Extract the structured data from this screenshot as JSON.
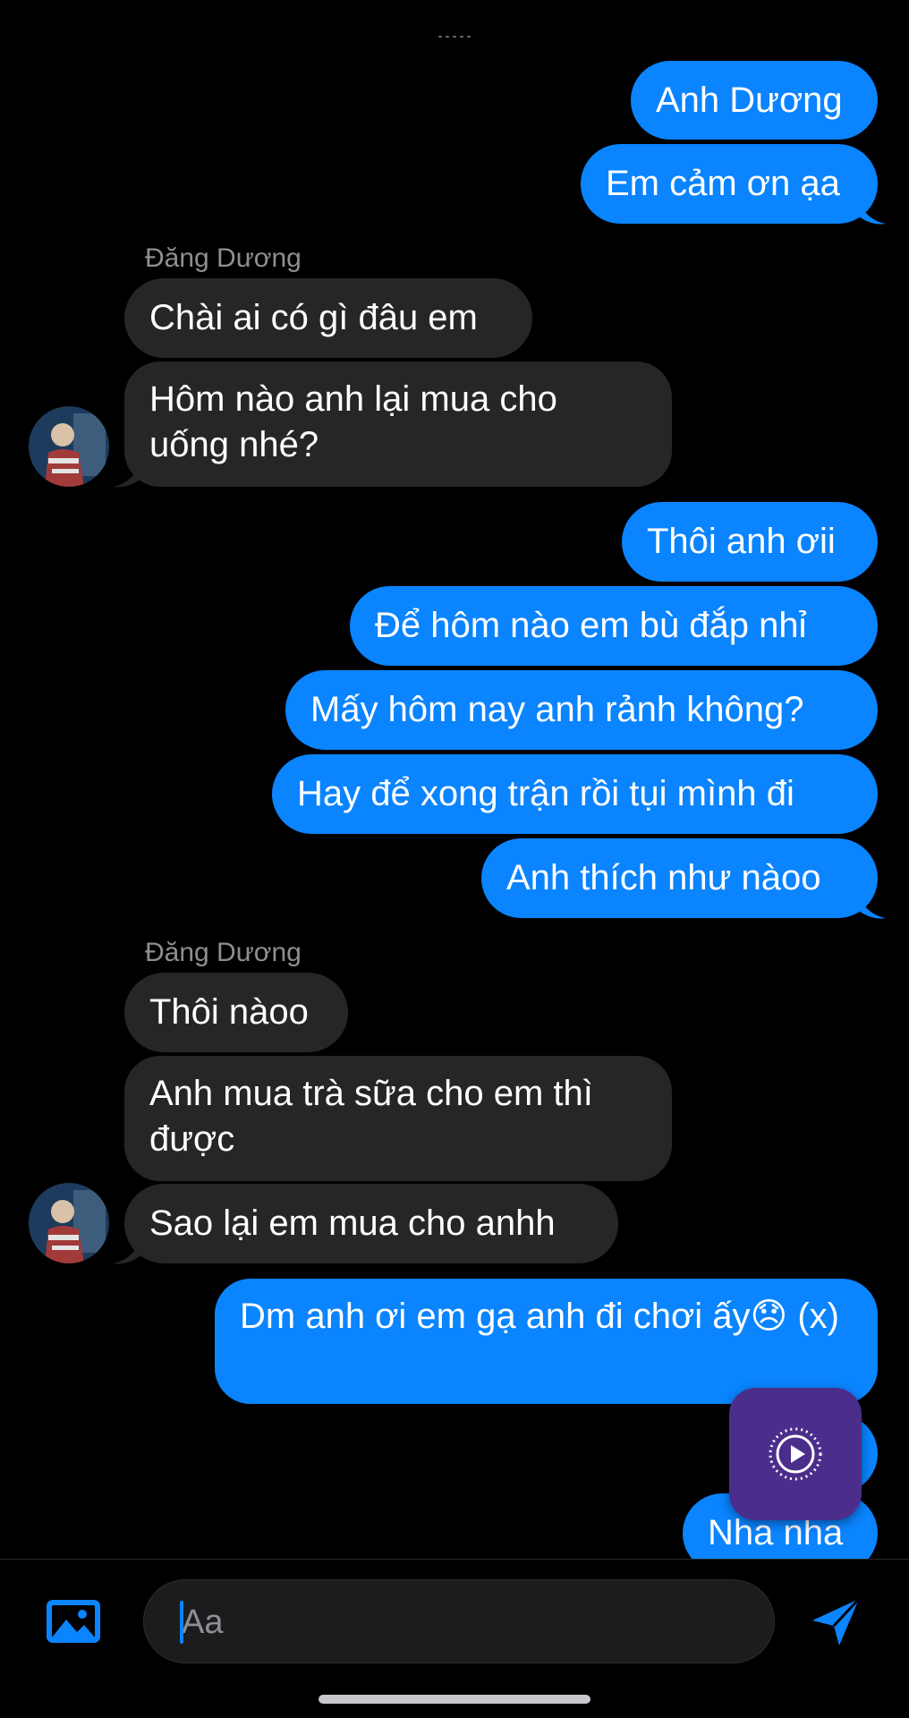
{
  "colors": {
    "outgoing_bubble": "#0a84ff",
    "incoming_bubble": "#262628",
    "video_button": "#4b2e8c"
  },
  "messages": [
    {
      "dir": "out",
      "text": "Anh Dương"
    },
    {
      "dir": "out",
      "text": "Em cảm ơn ạa"
    },
    {
      "dir": "in",
      "sender": "Đăng Dương",
      "text": "Chài ai có gì đâu em"
    },
    {
      "dir": "in",
      "text": "Hôm nào anh lại mua cho uống nhé?"
    },
    {
      "dir": "out",
      "text": "Thôi anh ơii"
    },
    {
      "dir": "out",
      "text": "Để hôm nào em bù đắp nhỉ"
    },
    {
      "dir": "out",
      "text": "Mấy hôm nay anh rảnh không?"
    },
    {
      "dir": "out",
      "text": "Hay để xong trận rồi tụi mình đi"
    },
    {
      "dir": "out",
      "text": "Anh thích như nàoo"
    },
    {
      "dir": "in",
      "sender": "Đăng Dương",
      "text": "Thôi nàoo"
    },
    {
      "dir": "in",
      "text": "Anh mua trà sữa cho em thì được"
    },
    {
      "dir": "in",
      "text": "Sao lại em mua cho anhh"
    },
    {
      "dir": "out",
      "text": "Dm anh ơi em gạ anh đi chơi ấy😞 (x)"
    },
    {
      "dir": "out",
      "text": ""
    },
    {
      "dir": "out",
      "text": "Nha nha"
    }
  ],
  "composer": {
    "placeholder": "Aa"
  },
  "icons": {
    "photo": "photo-icon",
    "send": "send-icon",
    "video": "play-circle-icon"
  }
}
